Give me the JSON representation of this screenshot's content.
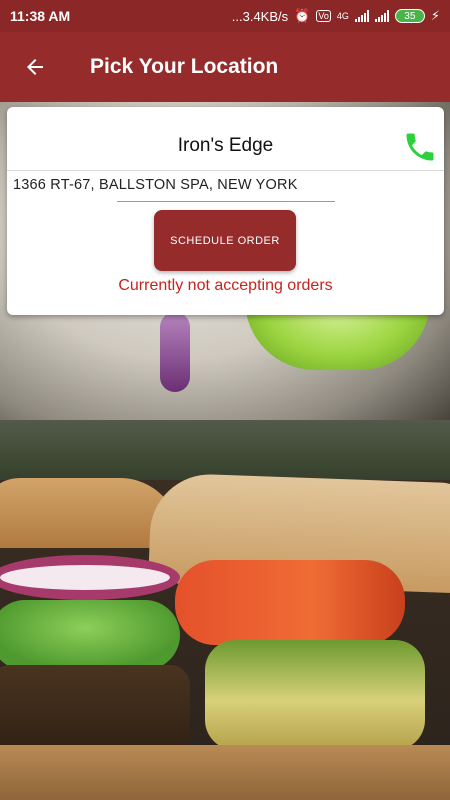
{
  "status_bar": {
    "time": "11:38 AM",
    "network_speed": "...3.4KB/s",
    "network_type": "4G",
    "battery_level": "35"
  },
  "app_bar": {
    "title": "Pick Your Location",
    "back_icon": "arrow-left-icon"
  },
  "location_card": {
    "name": "Iron's Edge",
    "address": "1366 RT-67, BALLSTON SPA, NEW YORK",
    "phone_icon": "phone-icon",
    "phone_icon_color": "#2bd13b",
    "schedule_button_label": "SCHEDULE ORDER",
    "order_status": "Currently not accepting orders",
    "order_status_color": "#c9231d"
  },
  "colors": {
    "primary": "#962b2b",
    "status_bar": "#8b2727"
  }
}
